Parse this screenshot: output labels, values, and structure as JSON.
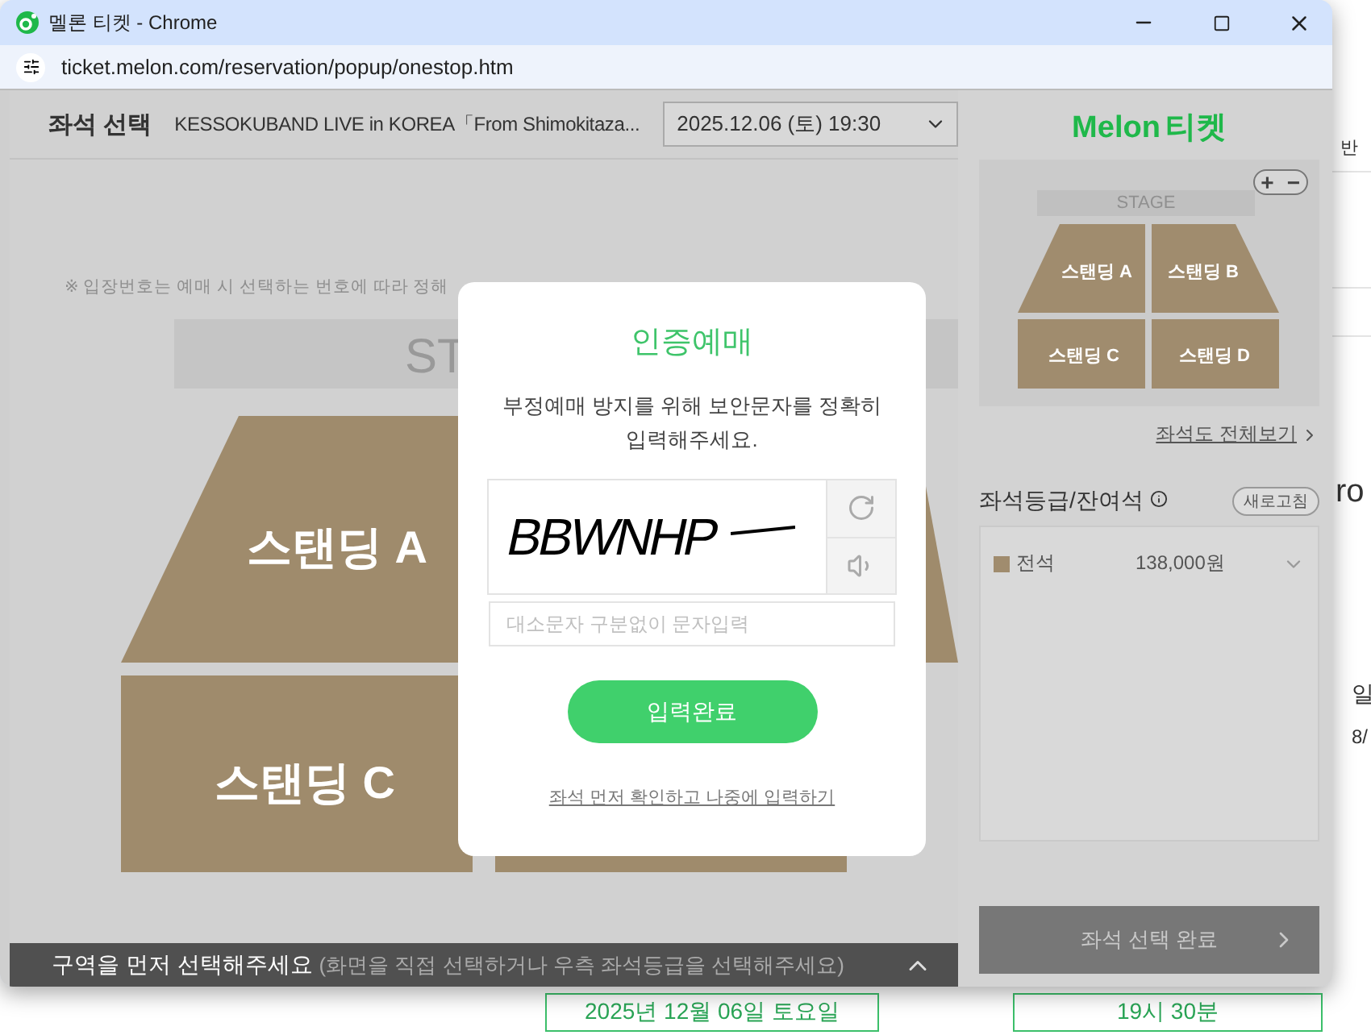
{
  "window": {
    "title": "멜론 티켓 - Chrome",
    "url": "ticket.melon.com/reservation/popup/onestop.htm"
  },
  "header": {
    "title": "좌석 선택",
    "concert": "KESSOKUBAND LIVE in KOREA「From Shimokitaza...",
    "date_select": "2025.12.06 (토) 19:30"
  },
  "seat_map": {
    "notice": "※ 입장번호는 예매 시 선택하는 번호에 따라 정해",
    "stage": "ST",
    "sections": [
      {
        "label": "스탠딩 A"
      },
      {
        "label": "스탠딩 C"
      }
    ]
  },
  "bottom_bar": {
    "title": "구역을 먼저 선택해주세요",
    "hint": "(화면을 직접 선택하거나 우측 좌석등급을 선택해주세요)"
  },
  "sidebar": {
    "logo": {
      "brand": "Melon",
      "suffix": "티켓"
    },
    "minimap": {
      "stage": "STAGE",
      "zoom_in": "+",
      "zoom_out": "−",
      "sections": [
        {
          "label": "스탠딩 A"
        },
        {
          "label": "스탠딩 B"
        },
        {
          "label": "스탠딩 C"
        },
        {
          "label": "스탠딩 D"
        }
      ]
    },
    "full_map_link": "좌석도 전체보기",
    "grades_title": "좌석등급/잔여석",
    "refresh": "새로고침",
    "grades": [
      {
        "name": "전석",
        "price": "138,000원",
        "color": "#a08c6e",
        "expanded": false
      }
    ],
    "confirm": "좌석 선택 완료"
  },
  "captcha_dialog": {
    "title": "인증예매",
    "message": "부정예매 방지를 위해 보안문자를 정확히 입력해주세요.",
    "captcha": "BBWNHP",
    "placeholder": "대소문자 구분없이 문자입력",
    "submit": "입력완료",
    "later_link": "좌석 먼저 확인하고 나중에 입력하기"
  },
  "background_page": {
    "fragments": [
      "반",
      "ro",
      "일",
      "8/"
    ],
    "date": "2025년 12월 06일 토요일",
    "time": "19시 30분"
  }
}
